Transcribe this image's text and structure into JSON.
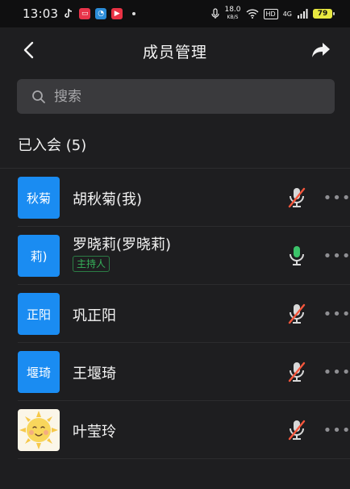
{
  "status_bar": {
    "time": "13:03",
    "speed_value": "18.0",
    "speed_unit": "KB/S",
    "hd": "HD",
    "signal": "4G",
    "battery": "79"
  },
  "header": {
    "title": "成员管理"
  },
  "search": {
    "placeholder": "搜索"
  },
  "section": {
    "title": "已入会 (5)"
  },
  "members": [
    {
      "avatar_text": "秋菊",
      "name": "胡秋菊(我)",
      "badge": "",
      "mic": "muted"
    },
    {
      "avatar_text": "莉)",
      "name": "罗晓莉(罗晓莉)",
      "badge": "主持人",
      "mic": "on"
    },
    {
      "avatar_text": "正阳",
      "name": "巩正阳",
      "badge": "",
      "mic": "muted"
    },
    {
      "avatar_text": "堰琦",
      "name": "王堰琦",
      "badge": "",
      "mic": "muted"
    },
    {
      "avatar_text": "",
      "avatar_image": "sun-smiley",
      "name": "叶莹玲",
      "badge": "",
      "mic": "muted"
    }
  ],
  "more_label": "•••",
  "colors": {
    "accent_blue": "#1a8cf2",
    "muted_red": "#f5563c",
    "mic_on_green": "#3cc36a",
    "background": "#1e1e20"
  }
}
